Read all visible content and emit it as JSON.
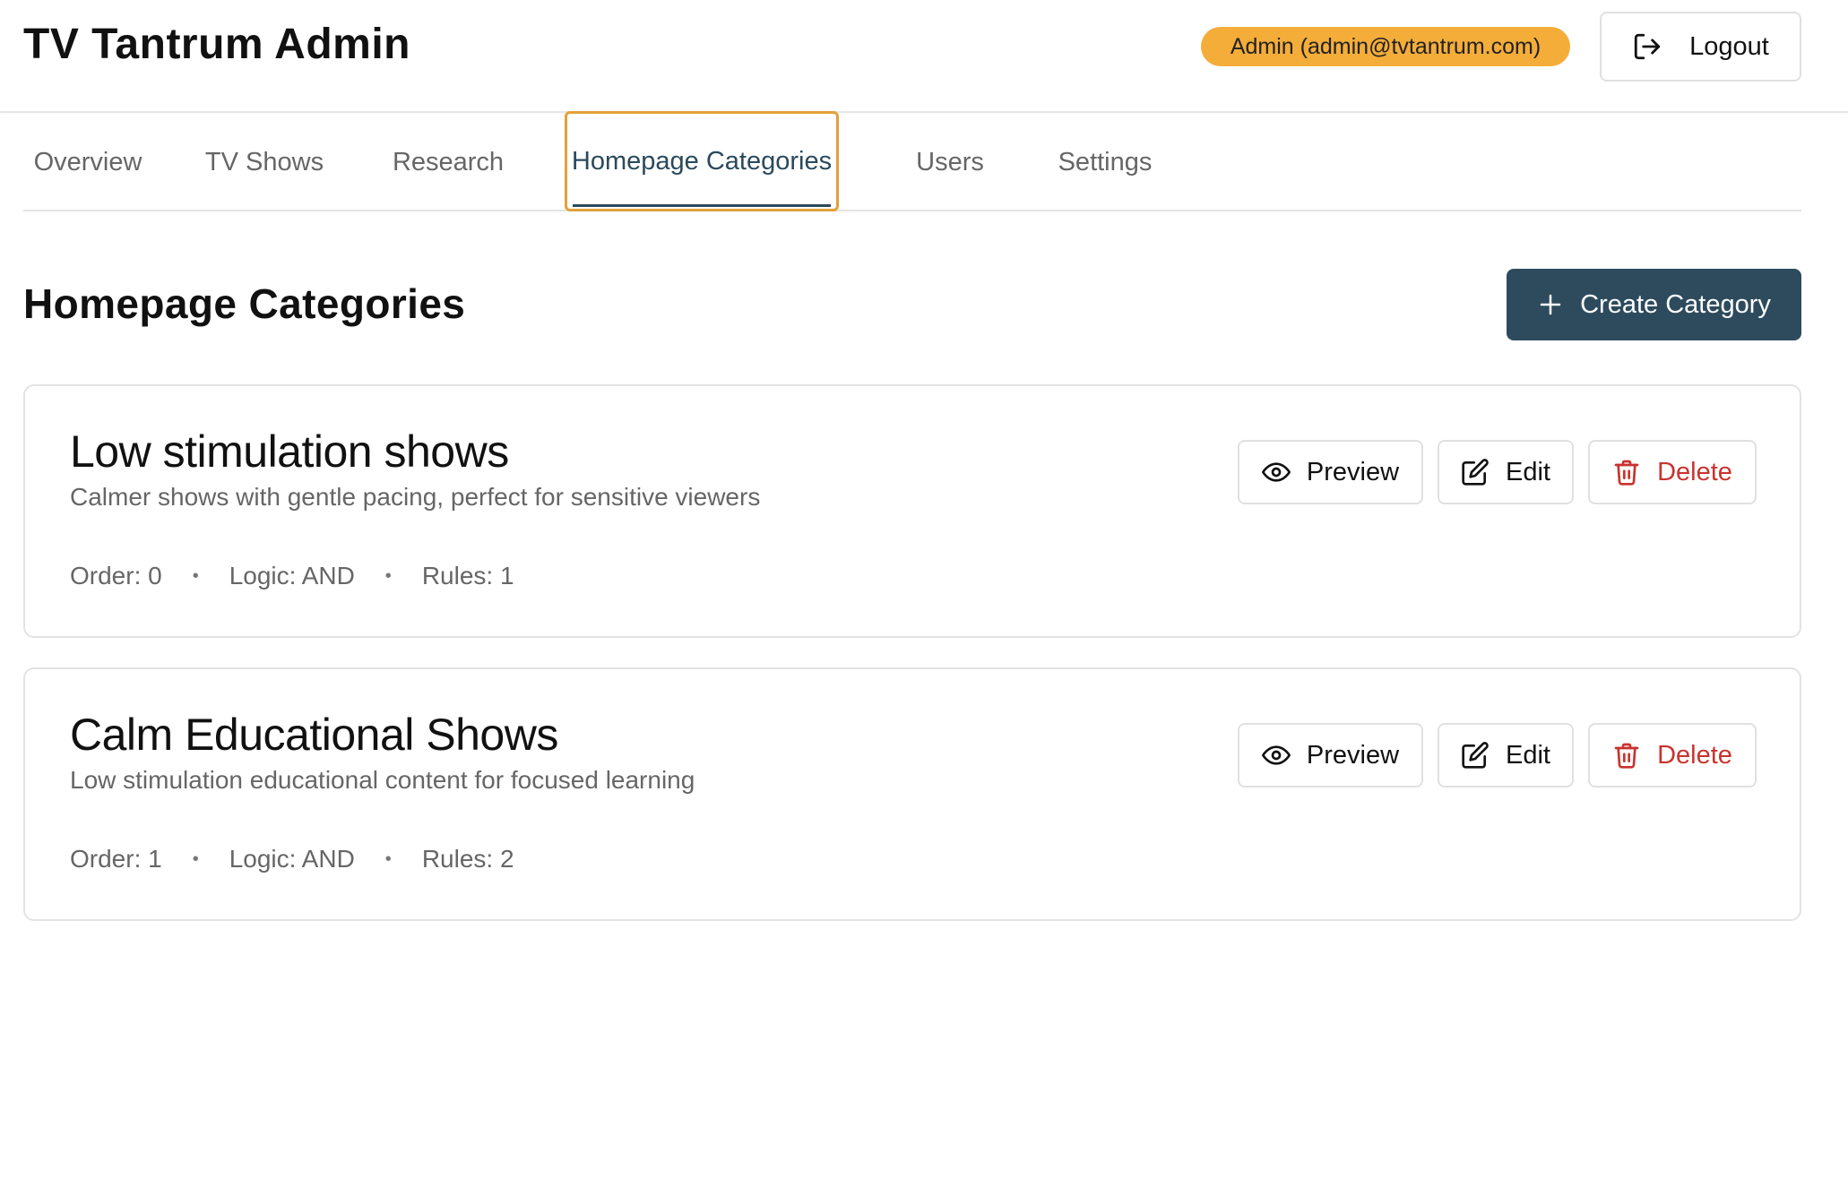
{
  "header": {
    "title": "TV Tantrum Admin",
    "admin_badge": "Admin (admin@tvtantrum.com)",
    "logout_label": "Logout"
  },
  "tabs": [
    {
      "label": "Overview"
    },
    {
      "label": "TV Shows"
    },
    {
      "label": "Research"
    },
    {
      "label": "Homepage Categories",
      "active": true
    },
    {
      "label": "Users"
    },
    {
      "label": "Settings"
    }
  ],
  "main": {
    "title": "Homepage Categories",
    "create_label": "Create Category"
  },
  "categories": [
    {
      "name": "Low stimulation shows",
      "description": "Calmer shows with gentle pacing, perfect for sensitive viewers",
      "order": "Order: 0",
      "logic": "Logic: AND",
      "rules": "Rules: 1"
    },
    {
      "name": "Calm Educational Shows",
      "description": "Low stimulation educational content for focused learning",
      "order": "Order: 1",
      "logic": "Logic: AND",
      "rules": "Rules: 2"
    }
  ],
  "card_actions": {
    "preview": "Preview",
    "edit": "Edit",
    "delete": "Delete",
    "separator": "•"
  },
  "colors": {
    "accent": "#2d4b5d",
    "badge": "#f5ad3a",
    "active_tab_outline": "#e3a03a",
    "danger": "#c8332e"
  },
  "icons": {
    "logout": "logout-icon",
    "create": "plus-icon",
    "preview": "eye-icon",
    "edit": "edit-icon",
    "delete": "trash-icon"
  }
}
